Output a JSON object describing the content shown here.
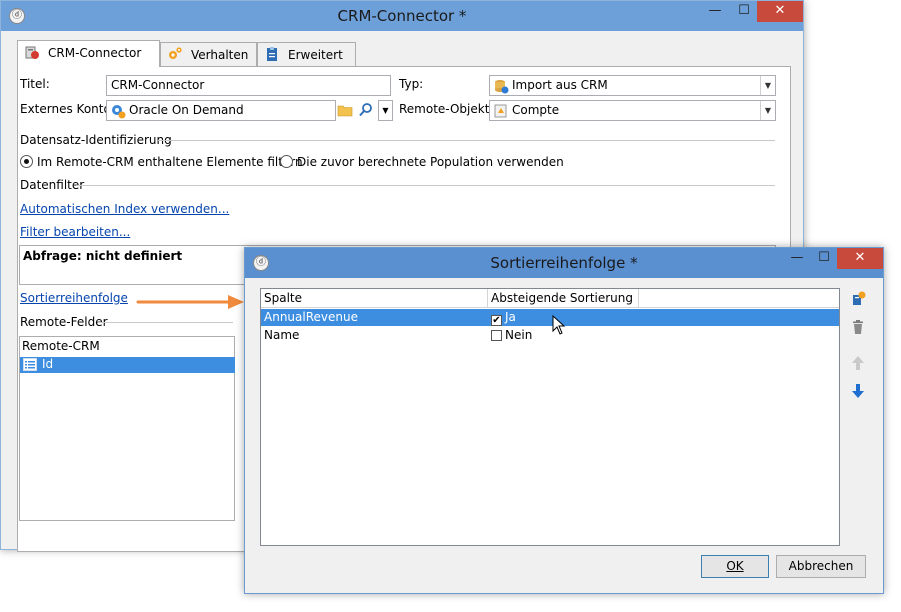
{
  "main_window": {
    "title": "CRM-Connector *",
    "controls": {
      "minimize": "—",
      "maximize": "☐",
      "close": "✕"
    },
    "tabs": [
      {
        "label": "CRM-Connector",
        "icon": "crm-connector-icon",
        "selected": true
      },
      {
        "label": "Verhalten",
        "icon": "gears-icon",
        "selected": false
      },
      {
        "label": "Erweitert",
        "icon": "clipboard-icon",
        "selected": false
      }
    ],
    "form": {
      "title_label": "Titel:",
      "title_value": "CRM-Connector",
      "type_label": "Typ:",
      "type_value": "Import aus CRM",
      "account_label": "Externes Konto:",
      "account_value": "Oracle On Demand",
      "remote_object_label": "Remote-Objekt:",
      "remote_object_value": "Compte"
    },
    "record_identification": {
      "heading": "Datensatz-Identifizierung",
      "option_filter": "Im Remote-CRM enthaltene Elemente filtern",
      "option_population": "Die zuvor berechnete Population verwenden",
      "selected": "filter"
    },
    "data_filter": {
      "heading": "Datenfilter",
      "auto_index_link": "Automatischen Index verwenden...",
      "edit_filter_link": "Filter bearbeiten...",
      "query_text": "Abfrage: nicht definiert"
    },
    "sort_order_link": "Sortierreihenfolge",
    "remote_fields": {
      "heading": "Remote-Felder",
      "column": "Remote-CRM",
      "rows": [
        "Id"
      ]
    }
  },
  "sort_dialog": {
    "title": "Sortierreihenfolge *",
    "controls": {
      "minimize": "—",
      "maximize": "☐",
      "close": "✕"
    },
    "columns": [
      "Spalte",
      "Absteigende Sortierung"
    ],
    "rows": [
      {
        "column": "AnnualRevenue",
        "descending": true,
        "label": "Ja",
        "selected": true
      },
      {
        "column": "Name",
        "descending": false,
        "label": "Nein",
        "selected": false
      }
    ],
    "ok_label": "OK",
    "cancel_label": "Abbrechen"
  },
  "colors": {
    "titlebar_active": "#5a8fd0",
    "titlebar_inactive": "#6d9fd8",
    "selection": "#3d8ee0",
    "link": "#0645ad",
    "arrow": "#f08a3c",
    "close_button": "#c74a3c"
  }
}
